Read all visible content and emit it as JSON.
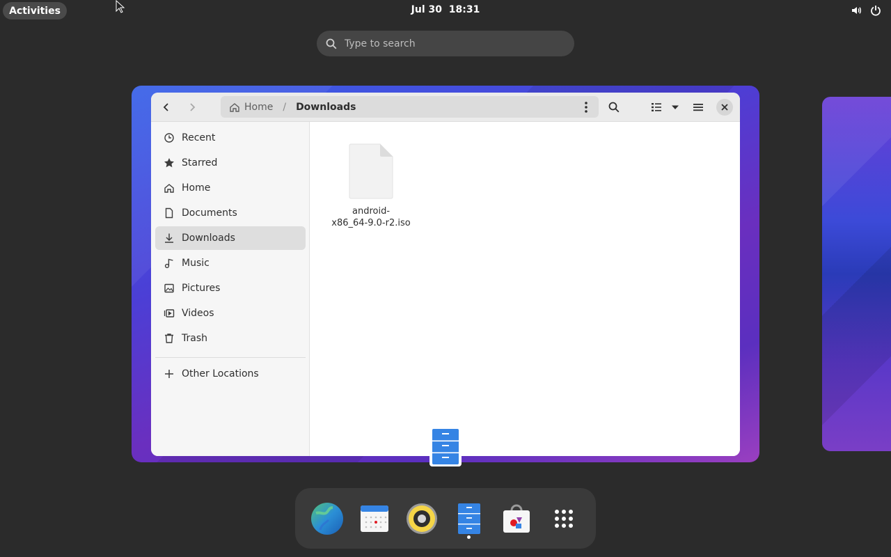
{
  "topbar": {
    "activities_label": "Activities",
    "clock": "Jul 30  18:31"
  },
  "search": {
    "placeholder": "Type to search"
  },
  "window": {
    "path": {
      "home_label": "Home",
      "separator": "/",
      "current_label": "Downloads"
    },
    "sidebar": {
      "items": [
        {
          "label": "Recent",
          "icon": "clock-icon"
        },
        {
          "label": "Starred",
          "icon": "star-icon"
        },
        {
          "label": "Home",
          "icon": "home-icon"
        },
        {
          "label": "Documents",
          "icon": "document-icon"
        },
        {
          "label": "Downloads",
          "icon": "download-icon",
          "active": true
        },
        {
          "label": "Music",
          "icon": "music-icon"
        },
        {
          "label": "Pictures",
          "icon": "picture-icon"
        },
        {
          "label": "Videos",
          "icon": "video-icon"
        },
        {
          "label": "Trash",
          "icon": "trash-icon"
        }
      ],
      "other_locations_label": "Other Locations"
    },
    "files": [
      {
        "name_line1": "android-",
        "name_line2": "x86_64-9.0-r2.iso"
      }
    ]
  },
  "dash": {
    "apps": [
      "web-browser-icon",
      "calendar-icon",
      "rhythmbox-icon",
      "files-icon",
      "software-icon",
      "show-apps-icon"
    ]
  },
  "colors": {
    "panel_bg": "#2b2b2b",
    "accent_blue": "#3584e4",
    "sidebar_active": "#dedede"
  }
}
